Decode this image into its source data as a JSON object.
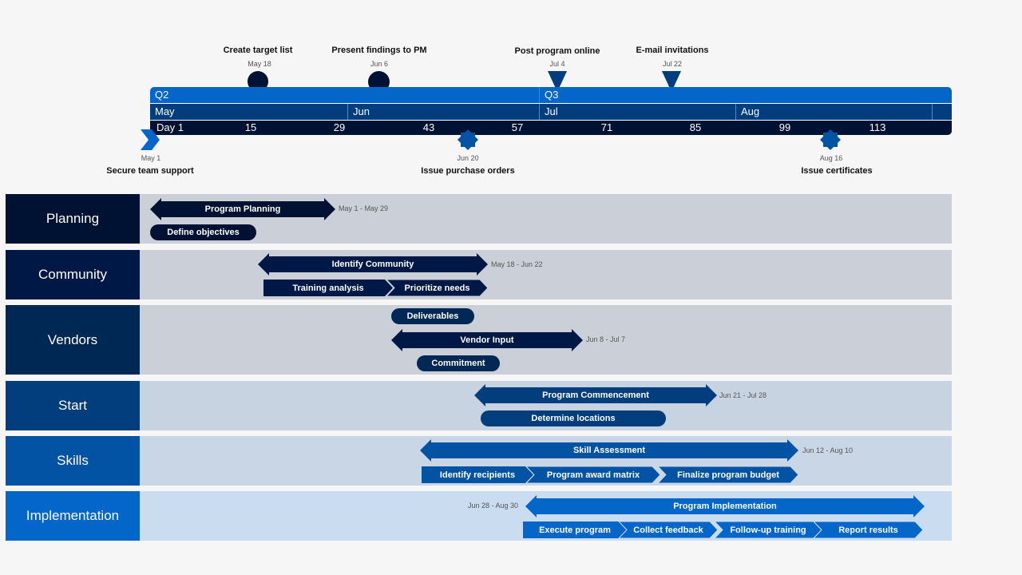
{
  "colors": {
    "q_band": "#0466c8",
    "m_band": "#023e7d",
    "d_band": "#001233",
    "planning": "#001233",
    "community": "#001845",
    "vendors": "#002855",
    "start": "#023e7d",
    "skills": "#0353a4",
    "implementation": "#0466c8"
  },
  "scale": {
    "quarters": [
      "Q2",
      "Q3"
    ],
    "months": [
      "May",
      "Jun",
      "Jul",
      "Aug"
    ],
    "days": [
      "Day 1",
      "15",
      "29",
      "43",
      "57",
      "71",
      "85",
      "99",
      "113"
    ]
  },
  "milestones_top": [
    {
      "title": "Create target list",
      "date": "May 18",
      "shape": "circle"
    },
    {
      "title": "Present findings to PM",
      "date": "Jun 6",
      "shape": "circle"
    },
    {
      "title": "Post program online",
      "date": "Jul 4",
      "shape": "triangle-down"
    },
    {
      "title": "E-mail invitations",
      "date": "Jul 22",
      "shape": "triangle-down"
    }
  ],
  "milestones_bottom": [
    {
      "title": "Secure team support",
      "date": "May 1",
      "shape": "chevron"
    },
    {
      "title": "Issue purchase orders",
      "date": "Jun 20",
      "shape": "star"
    },
    {
      "title": "Issue certificates",
      "date": "Aug 16",
      "shape": "star"
    }
  ],
  "swimlanes": [
    {
      "label": "Planning",
      "main": {
        "label": "Program Planning",
        "range": "May 1 - May 29"
      },
      "tasks": [
        "Define objectives"
      ]
    },
    {
      "label": "Community",
      "main": {
        "label": "Identify Community",
        "range": "May 18 - Jun 22"
      },
      "tasks": [
        "Training analysis",
        "Prioritize needs"
      ]
    },
    {
      "label": "Vendors",
      "main": {
        "label": "Vendor Input",
        "range": "Jun 8 - Jul 7"
      },
      "tasks": [
        "Deliverables",
        "Commitment"
      ]
    },
    {
      "label": "Start",
      "main": {
        "label": "Program Commencement",
        "range": "Jun 21 - Jul 28"
      },
      "tasks": [
        "Determine locations"
      ]
    },
    {
      "label": "Skills",
      "main": {
        "label": "Skill Assessment",
        "range": "Jun 12 - Aug 10"
      },
      "tasks": [
        "Identify recipients",
        "Program award matrix",
        "Finalize program budget"
      ]
    },
    {
      "label": "Implementation",
      "main": {
        "label": "Program Implementation",
        "range": "Jun 28 - Aug 30"
      },
      "tasks": [
        "Execute program",
        "Collect feedback",
        "Follow-up training",
        "Report results"
      ]
    }
  ]
}
